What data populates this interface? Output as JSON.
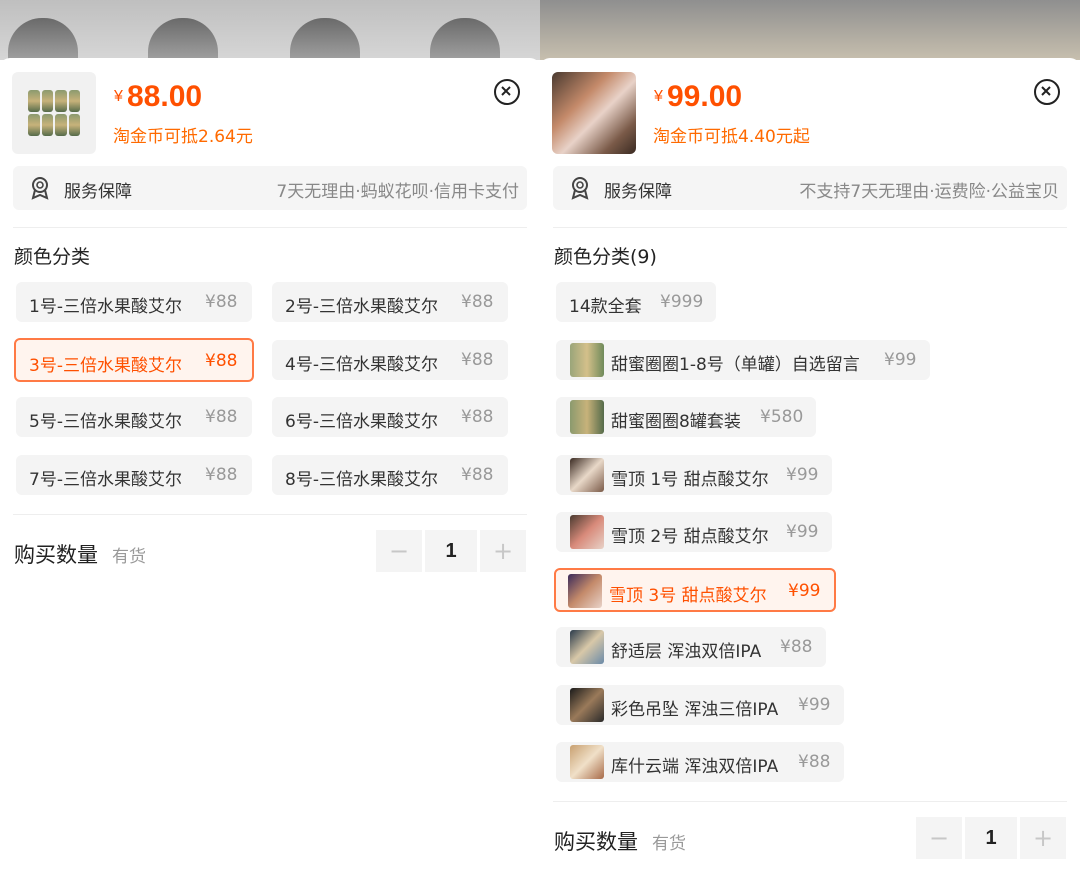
{
  "colors": {
    "accent": "#ff5000",
    "selected_border": "#ff7a45"
  },
  "left": {
    "price_symbol": "¥",
    "price": "88.00",
    "coin_text": "淘金币可抵2.64元",
    "service_title": "服务保障",
    "service_items": "7天无理由·蚂蚁花呗·信用卡支付",
    "section_title": "颜色分类",
    "options": [
      {
        "label": "1号-三倍水果酸艾尔",
        "price": "¥88",
        "selected": false
      },
      {
        "label": "2号-三倍水果酸艾尔",
        "price": "¥88",
        "selected": false
      },
      {
        "label": "3号-三倍水果酸艾尔",
        "price": "¥88",
        "selected": true
      },
      {
        "label": "4号-三倍水果酸艾尔",
        "price": "¥88",
        "selected": false
      },
      {
        "label": "5号-三倍水果酸艾尔",
        "price": "¥88",
        "selected": false
      },
      {
        "label": "6号-三倍水果酸艾尔",
        "price": "¥88",
        "selected": false
      },
      {
        "label": "7号-三倍水果酸艾尔",
        "price": "¥88",
        "selected": false
      },
      {
        "label": "8号-三倍水果酸艾尔",
        "price": "¥88",
        "selected": false
      }
    ],
    "qty_label": "购买数量",
    "stock": "有货",
    "qty_minus": "−",
    "qty_value": "1",
    "qty_plus": "+"
  },
  "right": {
    "price_symbol": "¥",
    "price": "99.00",
    "coin_text": "淘金币可抵4.40元起",
    "service_title": "服务保障",
    "service_items": "不支持7天无理由·运费险·公益宝贝",
    "section_title": "颜色分类(9)",
    "options": [
      {
        "label": "14款全套",
        "price": "¥999",
        "selected": false,
        "thumb": false
      },
      {
        "label": "甜蜜圈圈1-8号（单罐）自选留言",
        "price": "¥99",
        "selected": false,
        "thumb": true
      },
      {
        "label": "甜蜜圈圈8罐套装",
        "price": "¥580",
        "selected": false,
        "thumb": true
      },
      {
        "label": "雪顶 1号 甜点酸艾尔",
        "price": "¥99",
        "selected": false,
        "thumb": true
      },
      {
        "label": "雪顶 2号 甜点酸艾尔",
        "price": "¥99",
        "selected": false,
        "thumb": true
      },
      {
        "label": "雪顶 3号 甜点酸艾尔",
        "price": "¥99",
        "selected": true,
        "thumb": true
      },
      {
        "label": "舒适层 浑浊双倍IPA",
        "price": "¥88",
        "selected": false,
        "thumb": true
      },
      {
        "label": "彩色吊坠 浑浊三倍IPA",
        "price": "¥99",
        "selected": false,
        "thumb": true
      },
      {
        "label": "库什云端 浑浊双倍IPA",
        "price": "¥88",
        "selected": false,
        "thumb": true
      }
    ],
    "qty_label": "购买数量",
    "stock": "有货",
    "qty_minus": "−",
    "qty_value": "1",
    "qty_plus": "+"
  }
}
